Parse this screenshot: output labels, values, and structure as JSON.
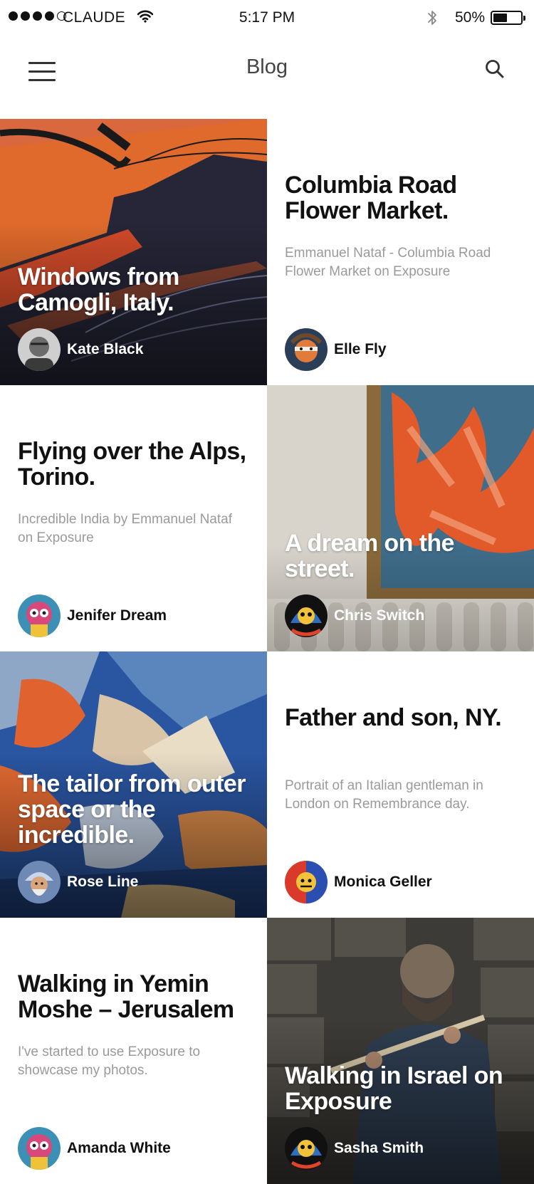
{
  "status_bar": {
    "carrier": "CLAUDE",
    "time": "5:17 PM",
    "battery_text": "50%",
    "battery_level": 0.5,
    "signal_bars_filled": 4,
    "signal_bars_total": 5
  },
  "header": {
    "title": "Blog",
    "left_icon": "hamburger-menu-icon",
    "right_icon": "search-icon"
  },
  "posts": [
    {
      "title": "Windows from Camogli, Italy.",
      "author": "Kate Black",
      "style": "image"
    },
    {
      "title": "Columbia Road Flower Market.",
      "description": "Emmanuel Nataf - Columbia Road Flower Market on Exposure",
      "author": "Elle Fly",
      "style": "text"
    },
    {
      "title": "Flying over the Alps, Torino.",
      "description": "Incredible India by Emmanuel Nataf on Exposure",
      "author": "Jenifer Dream",
      "style": "text"
    },
    {
      "title": "A dream on the street.",
      "author": "Chris Switch",
      "style": "image"
    },
    {
      "title": "The tailor from outer space or the incredible.",
      "author": "Rose Line",
      "style": "image"
    },
    {
      "title": "Father and son, NY.",
      "description": "Portrait of an Italian gentleman in London on Remembrance day.",
      "author": "Monica Geller",
      "style": "text"
    },
    {
      "title": "Walking in Yemin Moshe – Jerusalem",
      "description": "I've started to use Exposure to showcase my photos.",
      "author": "Amanda White",
      "style": "text"
    },
    {
      "title": "Walking in Israel on Exposure",
      "author": "Sasha Smith",
      "style": "image"
    }
  ],
  "colors": {
    "text_primary": "#111111",
    "text_secondary": "#9a9a9a",
    "nav_title": "#444444",
    "background": "#ffffff"
  }
}
